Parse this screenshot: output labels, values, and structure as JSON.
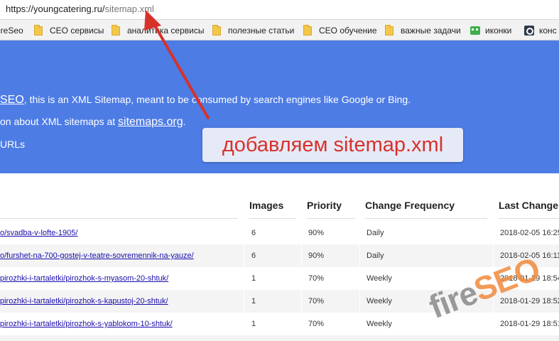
{
  "address_bar": {
    "url_host": "https://youngcatering.ru/",
    "url_path": "sitemap.xml"
  },
  "bookmarks": [
    {
      "label": "ireSeo",
      "icon": "none"
    },
    {
      "label": "CEO сервисы",
      "icon": "folder-icon"
    },
    {
      "label": "аналитика сервисы",
      "icon": "folder-icon"
    },
    {
      "label": "полезные статьи",
      "icon": "folder-icon"
    },
    {
      "label": "CEO обучение",
      "icon": "folder-icon"
    },
    {
      "label": "важные задачи",
      "icon": "folder-icon"
    },
    {
      "label": "иконки",
      "icon": "invader-icon"
    },
    {
      "label": "конс",
      "icon": "search-site-icon"
    }
  ],
  "header": {
    "line1_link": "SEO",
    "line1_text": ", this is an XML Sitemap, meant to be consumed by search engines like Google or Bing.",
    "line2_text": "on about XML sitemaps at ",
    "line2_link": "sitemaps.org",
    "line2_end": ".",
    "line3_text": "URLs"
  },
  "callout": {
    "text": "добавляем sitemap.xml",
    "text_color": "#d8312a"
  },
  "table": {
    "headers": {
      "images": "Images",
      "priority": "Priority",
      "frequency": "Change Frequency",
      "last_change": "Last Change"
    },
    "rows": [
      {
        "url": "o/svadba-v-lofte-1905/",
        "images": "6",
        "priority": "90%",
        "frequency": "Daily",
        "last_change": "2018-02-05 16:25"
      },
      {
        "url": "o/furshet-na-700-gostej-v-teatre-sovremennik-na-yauze/",
        "images": "6",
        "priority": "90%",
        "frequency": "Daily",
        "last_change": "2018-02-05 16:11"
      },
      {
        "url": "pirozhki-i-tartaletki/pirozhok-s-myasom-20-shtuk/",
        "images": "1",
        "priority": "70%",
        "frequency": "Weekly",
        "last_change": "2018-01-29 18:54"
      },
      {
        "url": "pirozhki-i-tartaletki/pirozhok-s-kapustoj-20-shtuk/",
        "images": "1",
        "priority": "70%",
        "frequency": "Weekly",
        "last_change": "2018-01-29 18:52"
      },
      {
        "url": "pirozhki-i-tartaletki/pirozhok-s-yablokom-10-shtuk/",
        "images": "1",
        "priority": "70%",
        "frequency": "Weekly",
        "last_change": "2018-01-29 18:51"
      }
    ]
  },
  "watermark": {
    "part1": "fire",
    "part2": "SEO",
    "color1": "#8a8a8a",
    "color2": "#f08a3c"
  },
  "colors": {
    "header_bg": "#4d7ce5",
    "arrow": "#d8312a",
    "link": "#1a0dab"
  }
}
